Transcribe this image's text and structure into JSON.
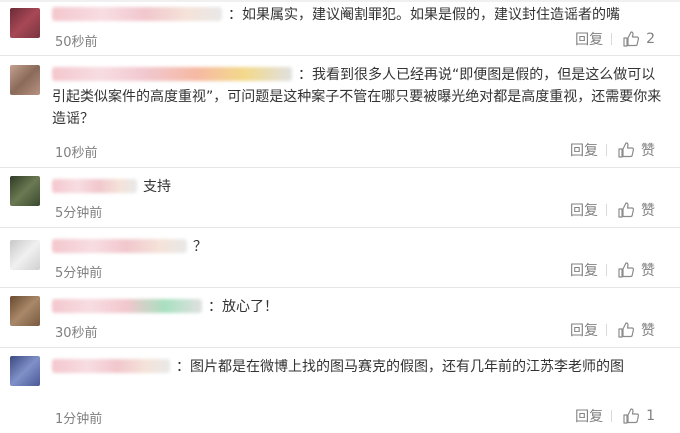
{
  "comments": [
    {
      "text": "：如果属实，建议阉割罪犯。如果是假的，建议封住造谣者的嘴",
      "time": "50秒前",
      "reply": "回复",
      "like": "2",
      "avatar_color": "#8a3b46"
    },
    {
      "text": "：我看到很多人已经再说“即便图是假的，但是这么做可以引起类似案件的高度重视”，可问题是这种案子不管在哪只要被曝光绝对都是高度重视，还需要你来造谣？",
      "time": "10秒前",
      "reply": "回复",
      "like": "赞",
      "avatar_color": "#a07a6a"
    },
    {
      "text": "支持",
      "time": "5分钟前",
      "reply": "回复",
      "like": "赞",
      "avatar_color": "#4a5a3a"
    },
    {
      "text": "？",
      "time": "5分钟前",
      "reply": "回复",
      "like": "赞",
      "avatar_color": "#d8d8d8"
    },
    {
      "text": "：放心了！",
      "time": "30秒前",
      "reply": "回复",
      "like": "赞",
      "avatar_color": "#8a6a50"
    },
    {
      "text": "：图片都是在微博上找的图马赛克的假图，还有几年前的江苏李老师的图",
      "time": "1分钟前",
      "reply": "回复",
      "like": "1",
      "avatar_color": "#5a6aa0"
    }
  ]
}
